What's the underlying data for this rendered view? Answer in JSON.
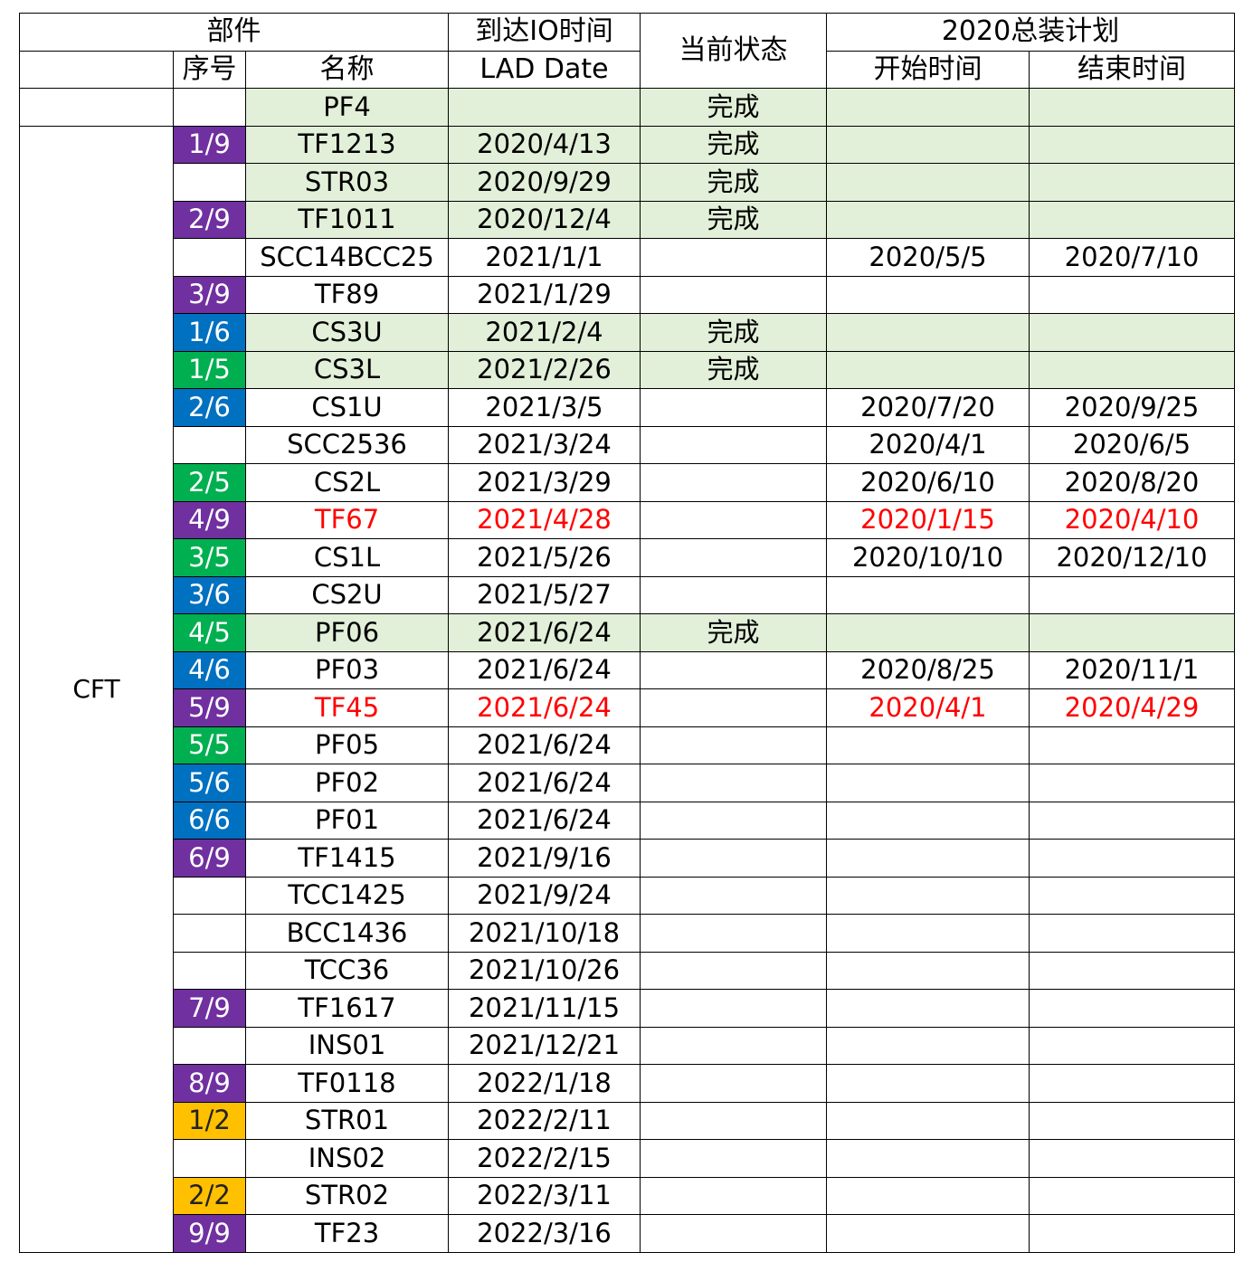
{
  "header": {
    "part": "部件",
    "seq": "序号",
    "name": "名称",
    "io_time": "到达IO时间",
    "lad_date": "LAD Date",
    "status": "当前状态",
    "plan": "2020总装计划",
    "start": "开始时间",
    "end": "结束时间"
  },
  "group_label": "CFT",
  "colors": {
    "purple": "#7030a0",
    "blue": "#0070c0",
    "green": "#00b050",
    "orange": "#ffc000",
    "done_bg": "#e2efd9",
    "highlight_text": "#ff0000"
  },
  "rows": [
    {
      "seq": "",
      "color": "",
      "name": "PF4",
      "lad": "",
      "status": "完成",
      "start": "",
      "end": "",
      "done": true,
      "red": false
    },
    {
      "seq": "1/9",
      "color": "purple",
      "name": "TF1213",
      "lad": "2020/4/13",
      "status": "完成",
      "start": "",
      "end": "",
      "done": true,
      "red": false
    },
    {
      "seq": "",
      "color": "",
      "name": "STR03",
      "lad": "2020/9/29",
      "status": "完成",
      "start": "",
      "end": "",
      "done": true,
      "red": false
    },
    {
      "seq": "2/9",
      "color": "purple",
      "name": "TF1011",
      "lad": "2020/12/4",
      "status": "完成",
      "start": "",
      "end": "",
      "done": true,
      "red": false
    },
    {
      "seq": "",
      "color": "",
      "name": "SCC14BCC25",
      "lad": "2021/1/1",
      "status": "",
      "start": "2020/5/5",
      "end": "2020/7/10",
      "done": false,
      "red": false
    },
    {
      "seq": "3/9",
      "color": "purple",
      "name": "TF89",
      "lad": "2021/1/29",
      "status": "",
      "start": "",
      "end": "",
      "done": false,
      "red": false
    },
    {
      "seq": "1/6",
      "color": "blue",
      "name": "CS3U",
      "lad": "2021/2/4",
      "status": "完成",
      "start": "",
      "end": "",
      "done": true,
      "red": false
    },
    {
      "seq": "1/5",
      "color": "green",
      "name": "CS3L",
      "lad": "2021/2/26",
      "status": "完成",
      "start": "",
      "end": "",
      "done": true,
      "red": false
    },
    {
      "seq": "2/6",
      "color": "blue",
      "name": "CS1U",
      "lad": "2021/3/5",
      "status": "",
      "start": "2020/7/20",
      "end": "2020/9/25",
      "done": false,
      "red": false
    },
    {
      "seq": "",
      "color": "",
      "name": "SCC2536",
      "lad": "2021/3/24",
      "status": "",
      "start": "2020/4/1",
      "end": "2020/6/5",
      "done": false,
      "red": false
    },
    {
      "seq": "2/5",
      "color": "green",
      "name": "CS2L",
      "lad": "2021/3/29",
      "status": "",
      "start": "2020/6/10",
      "end": "2020/8/20",
      "done": false,
      "red": false
    },
    {
      "seq": "4/9",
      "color": "purple",
      "name": "TF67",
      "lad": "2021/4/28",
      "status": "",
      "start": "2020/1/15",
      "end": "2020/4/10",
      "done": false,
      "red": true
    },
    {
      "seq": "3/5",
      "color": "green",
      "name": "CS1L",
      "lad": "2021/5/26",
      "status": "",
      "start": "2020/10/10",
      "end": "2020/12/10",
      "done": false,
      "red": false
    },
    {
      "seq": "3/6",
      "color": "blue",
      "name": "CS2U",
      "lad": "2021/5/27",
      "status": "",
      "start": "",
      "end": "",
      "done": false,
      "red": false
    },
    {
      "seq": "4/5",
      "color": "green",
      "name": "PF06",
      "lad": "2021/6/24",
      "status": "完成",
      "start": "",
      "end": "",
      "done": true,
      "red": false
    },
    {
      "seq": "4/6",
      "color": "blue",
      "name": "PF03",
      "lad": "2021/6/24",
      "status": "",
      "start": "2020/8/25",
      "end": "2020/11/1",
      "done": false,
      "red": false
    },
    {
      "seq": "5/9",
      "color": "purple",
      "name": "TF45",
      "lad": "2021/6/24",
      "status": "",
      "start": "2020/4/1",
      "end": "2020/4/29",
      "done": false,
      "red": true
    },
    {
      "seq": "5/5",
      "color": "green",
      "name": "PF05",
      "lad": "2021/6/24",
      "status": "",
      "start": "",
      "end": "",
      "done": false,
      "red": false
    },
    {
      "seq": "5/6",
      "color": "blue",
      "name": "PF02",
      "lad": "2021/6/24",
      "status": "",
      "start": "",
      "end": "",
      "done": false,
      "red": false
    },
    {
      "seq": "6/6",
      "color": "blue",
      "name": "PF01",
      "lad": "2021/6/24",
      "status": "",
      "start": "",
      "end": "",
      "done": false,
      "red": false
    },
    {
      "seq": "6/9",
      "color": "purple",
      "name": "TF1415",
      "lad": "2021/9/16",
      "status": "",
      "start": "",
      "end": "",
      "done": false,
      "red": false
    },
    {
      "seq": "",
      "color": "",
      "name": "TCC1425",
      "lad": "2021/9/24",
      "status": "",
      "start": "",
      "end": "",
      "done": false,
      "red": false
    },
    {
      "seq": "",
      "color": "",
      "name": "BCC1436",
      "lad": "2021/10/18",
      "status": "",
      "start": "",
      "end": "",
      "done": false,
      "red": false
    },
    {
      "seq": "",
      "color": "",
      "name": "TCC36",
      "lad": "2021/10/26",
      "status": "",
      "start": "",
      "end": "",
      "done": false,
      "red": false
    },
    {
      "seq": "7/9",
      "color": "purple",
      "name": "TF1617",
      "lad": "2021/11/15",
      "status": "",
      "start": "",
      "end": "",
      "done": false,
      "red": false
    },
    {
      "seq": "",
      "color": "",
      "name": "INS01",
      "lad": "2021/12/21",
      "status": "",
      "start": "",
      "end": "",
      "done": false,
      "red": false
    },
    {
      "seq": "8/9",
      "color": "purple",
      "name": "TF0118",
      "lad": "2022/1/18",
      "status": "",
      "start": "",
      "end": "",
      "done": false,
      "red": false
    },
    {
      "seq": "1/2",
      "color": "orange",
      "name": "STR01",
      "lad": "2022/2/11",
      "status": "",
      "start": "",
      "end": "",
      "done": false,
      "red": false
    },
    {
      "seq": "",
      "color": "",
      "name": "INS02",
      "lad": "2022/2/15",
      "status": "",
      "start": "",
      "end": "",
      "done": false,
      "red": false
    },
    {
      "seq": "2/2",
      "color": "orange",
      "name": "STR02",
      "lad": "2022/3/11",
      "status": "",
      "start": "",
      "end": "",
      "done": false,
      "red": false
    },
    {
      "seq": "9/9",
      "color": "purple",
      "name": "TF23",
      "lad": "2022/3/16",
      "status": "",
      "start": "",
      "end": "",
      "done": false,
      "red": false
    }
  ]
}
